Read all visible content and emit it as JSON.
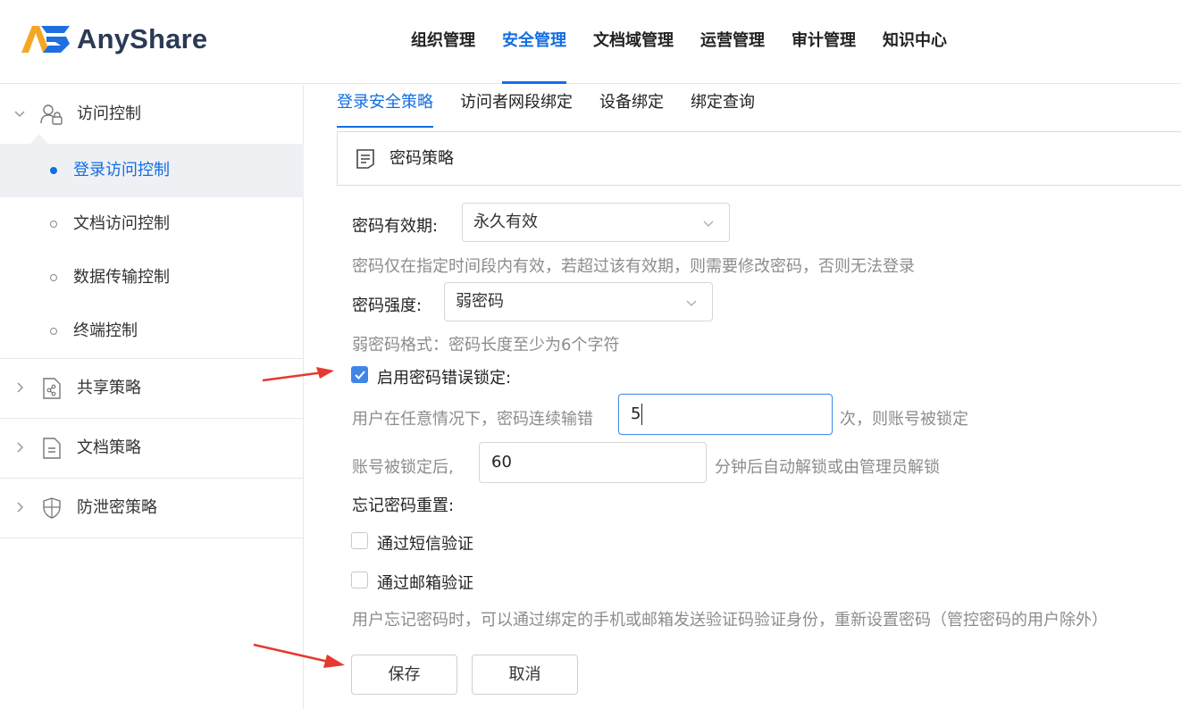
{
  "app": {
    "name": "AnyShare"
  },
  "topnav": {
    "items": [
      {
        "label": "组织管理"
      },
      {
        "label": "安全管理"
      },
      {
        "label": "文档域管理"
      },
      {
        "label": "运营管理"
      },
      {
        "label": "审计管理"
      },
      {
        "label": "知识中心"
      }
    ],
    "active": "安全管理"
  },
  "sidebar": {
    "groups": [
      {
        "label": "访问控制",
        "expanded": true,
        "icon": "users-icon",
        "items": [
          {
            "label": "登录访问控制",
            "active": true
          },
          {
            "label": "文档访问控制"
          },
          {
            "label": "数据传输控制"
          },
          {
            "label": "终端控制"
          }
        ]
      },
      {
        "label": "共享策略",
        "icon": "share-document-icon"
      },
      {
        "label": "文档策略",
        "icon": "document-icon"
      },
      {
        "label": "防泄密策略",
        "icon": "shield-icon"
      }
    ]
  },
  "tabs": [
    {
      "label": "登录安全策略",
      "active": true
    },
    {
      "label": "访问者网段绑定"
    },
    {
      "label": "设备绑定"
    },
    {
      "label": "绑定查询"
    }
  ],
  "panel": {
    "title": "密码策略",
    "icon": "list-document-icon"
  },
  "form": {
    "validity_label": "密码有效期:",
    "validity_value": "永久有效",
    "validity_hint": "密码仅在指定时间段内有效，若超过该有效期，则需要修改密码，否则无法登录",
    "strength_label": "密码强度:",
    "strength_value": "弱密码",
    "strength_hint": "弱密码格式：密码长度至少为6个字符",
    "lock_label": "启用密码错误锁定:",
    "lock_enabled": true,
    "lock_prefix": "用户在任意情况下，密码连续输错",
    "lock_count": "5",
    "lock_suffix": "次，则账号被锁定",
    "unlock_prefix": "账号被锁定后,",
    "unlock_minutes": "60",
    "unlock_suffix": "分钟后自动解锁或由管理员解锁",
    "reset_label": "忘记密码重置:",
    "sms_label": "通过短信验证",
    "sms_checked": false,
    "email_label": "通过邮箱验证",
    "email_checked": false,
    "reset_hint": "用户忘记密码时，可以通过绑定的手机或邮箱发送验证码验证身份，重新设置密码（管控密码的用户除外）"
  },
  "buttons": {
    "save": "保存",
    "cancel": "取消"
  },
  "colors": {
    "accent": "#126ee3",
    "arrow": "#e53a2f",
    "checkbox": "#3f86e8"
  }
}
